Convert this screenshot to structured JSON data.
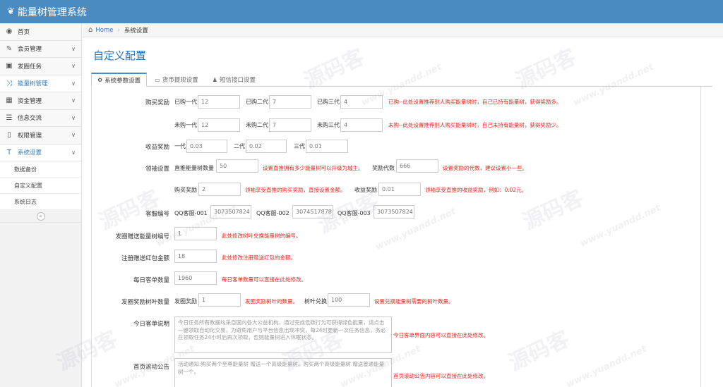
{
  "app": {
    "title": "能量树管理系统",
    "logo_icon": "leaf-icon"
  },
  "sidebar": {
    "items": [
      {
        "label": "首页",
        "icon": "dashboard-icon",
        "glyph": "◉",
        "has_chevron": false
      },
      {
        "label": "会员管理",
        "icon": "edit-icon",
        "glyph": "✎",
        "has_chevron": true
      },
      {
        "label": "发圈任务",
        "icon": "image-icon",
        "glyph": "▣",
        "has_chevron": true
      },
      {
        "label": "能量树管理",
        "icon": "random-icon",
        "glyph": "⤨",
        "has_chevron": true,
        "active": true
      },
      {
        "label": "资金管理",
        "icon": "calendar-icon",
        "glyph": "▦",
        "has_chevron": true
      },
      {
        "label": "信息交流",
        "icon": "list-icon",
        "glyph": "☰",
        "has_chevron": true
      },
      {
        "label": "权限管理",
        "icon": "file-icon",
        "glyph": "▯",
        "has_chevron": true
      },
      {
        "label": "系统设置",
        "icon": "text-icon",
        "glyph": "T",
        "has_chevron": true,
        "active": true
      }
    ],
    "subitems": [
      "数据备份",
      "自定义配置",
      "系统日志"
    ],
    "collapse_glyph": "«",
    "chevron_glyph": "∨"
  },
  "breadcrumb": {
    "home": "Home",
    "current": "系统设置"
  },
  "page_title": "自定义配置",
  "tabs": [
    {
      "label": "系统参数设置",
      "icon": "cogs-icon",
      "glyph": "⚙",
      "active": true
    },
    {
      "label": "货币提现设置",
      "icon": "credit-card-icon",
      "glyph": "▭"
    },
    {
      "label": "短信接口设置",
      "icon": "user-icon",
      "glyph": "♟"
    }
  ],
  "form": {
    "purchase_reward": {
      "label": "购买奖励",
      "bought": [
        {
          "label": "已购一代",
          "value": "12"
        },
        {
          "label": "已购二代",
          "value": "7"
        },
        {
          "label": "已购三代",
          "value": "4"
        }
      ],
      "bought_hint": "已购--此处设置推荐别人购买能量树时，自己已持有能量树，获得奖励多。",
      "unbought": [
        {
          "label": "未购一代",
          "value": "12"
        },
        {
          "label": "未购二代",
          "value": "7"
        },
        {
          "label": "未购三代",
          "value": "4"
        }
      ],
      "unbought_hint": "未购--此处设置推荐别人购买能量树时，自己未持有能量树，获得奖励少。"
    },
    "income_reward": {
      "label": "收益奖励",
      "gens": [
        {
          "label": "一代",
          "value": "0.03"
        },
        {
          "label": "二代",
          "value": "0.02"
        },
        {
          "label": "三代",
          "value": "0.01"
        }
      ]
    },
    "leader": {
      "label": "领袖设置",
      "direct_label": "直推能量树数量",
      "direct_value": "50",
      "direct_hint": "设置直推拥有多少能量树可以升级为城主。",
      "gen_label": "奖励代数",
      "gen_value": "666",
      "gen_hint": "设置奖励的代数，建议设置小一些。",
      "buy_label": "购买奖励",
      "buy_value": "2",
      "buy_hint": "领袖享受直推的购买奖励，直接设置金额。",
      "income_label": "收益奖励",
      "income_value": "0.01",
      "income_hint": "领袖享受直推的收益奖励，例如：0.02元。"
    },
    "customer_service": {
      "label": "客服编号",
      "items": [
        {
          "label": "QQ客服-001",
          "value": "3073507824"
        },
        {
          "label": "QQ客服-002",
          "value": "3074517878"
        },
        {
          "label": "QQ客服-003",
          "value": "3073507824"
        }
      ]
    },
    "gift_tree_no": {
      "label": "发圈赠送能量树编号",
      "value": "1",
      "hint": "此处修改树叶兑换能量树的编号。"
    },
    "reg_bonus": {
      "label": "注册赠送红包金额",
      "value": "18",
      "hint": "此处修改注册赠送红包的金额。"
    },
    "daily_orders": {
      "label": "每日客单数量",
      "value": "1960",
      "hint": "每日客单数量可以直接在此处修改。"
    },
    "leaf_count": {
      "label": "发圈奖励树叶数量",
      "reward_label": "发圈奖励",
      "reward_value": "1",
      "reward_hint": "发圈奖励树叶的数量。",
      "exchange_label": "树叶兑换",
      "exchange_value": "100",
      "exchange_hint": "设置兑换能量树需要的树叶数量。"
    },
    "daily_desc": {
      "label": "今日客单说明",
      "value": "今日任务所有数据均采自国内各大公益机构，通过完成低碳行为可获得绿色能量，请点击一键领取自动化交易，为避免用户与平台信息出现冲突，每24时更新一次任务信息，务必在领取任务24小时后再次领取，否则能量树进入休眠状态。",
      "hint": "今日客单界面内容可以直接在此处修改。"
    },
    "scroll_notice": {
      "label": "首页滚动公告",
      "value": "活动通知:购买两个至尊能量树 赠送一个高级能量树，购买两个高级能量树 赠送普通能量树一个。",
      "hint": "首页滚动公告内容可以直接在此处修改。"
    }
  },
  "watermark": {
    "text": "源码客",
    "url": "www.yuandd.net"
  },
  "colors": {
    "topbar": "#4a8bc2",
    "accent": "#3879b5",
    "hint": "#e0261d"
  }
}
